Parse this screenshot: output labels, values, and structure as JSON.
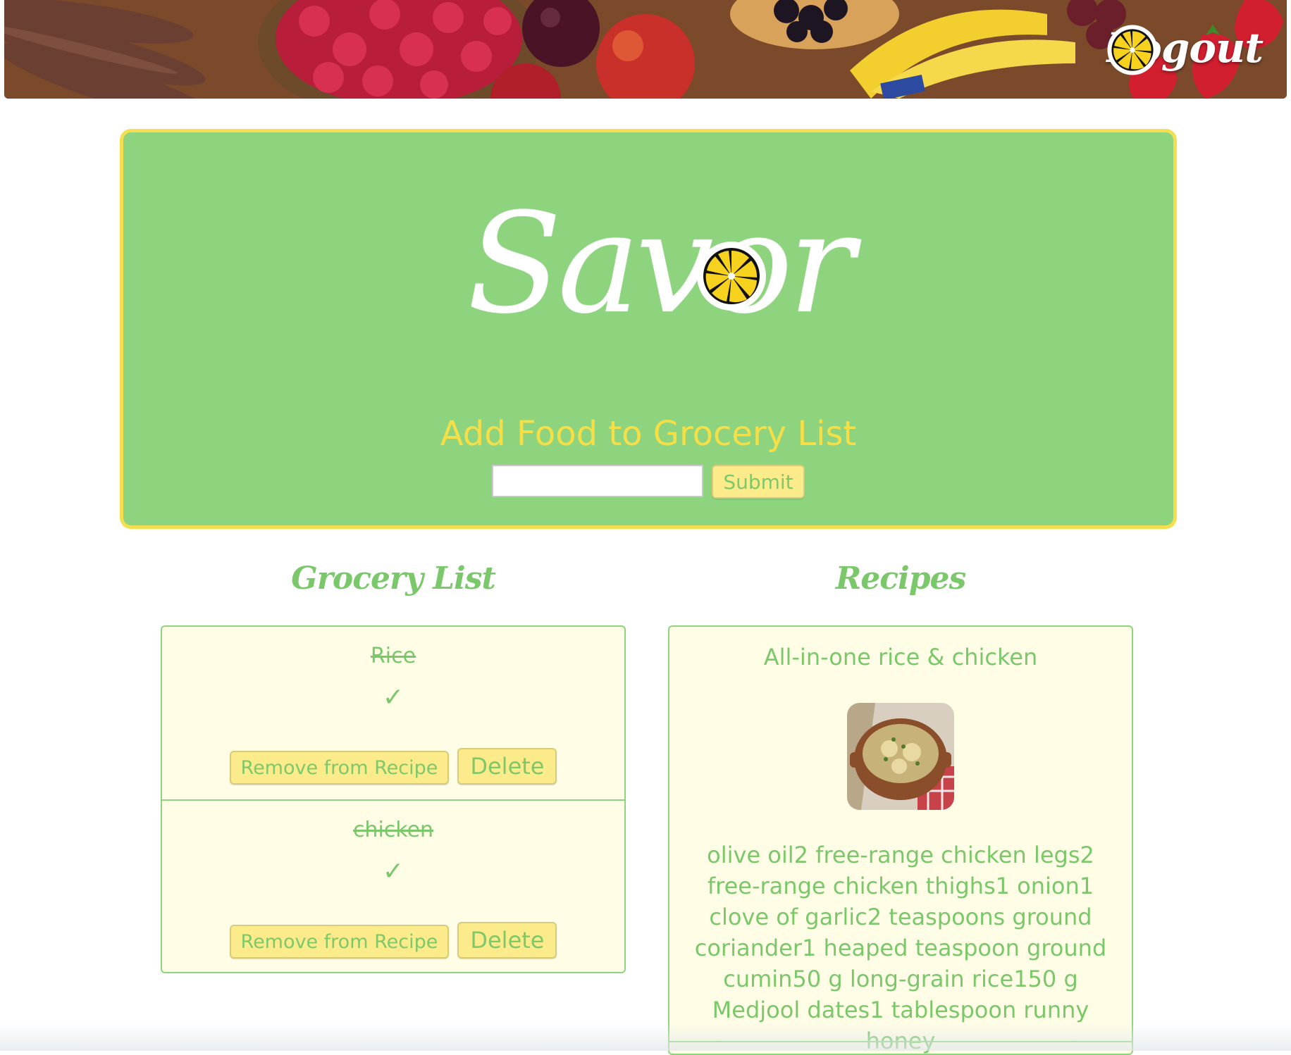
{
  "header": {
    "logout_label": "Logout",
    "logout_icon": "lemon-slice-icon"
  },
  "hero": {
    "logo_text": "Savor",
    "logo_icon": "lemon-slice-icon",
    "add_title": "Add Food to Grocery List",
    "input_value": "",
    "submit_label": "Submit"
  },
  "grocery": {
    "title": "Grocery List",
    "items": [
      {
        "name": "Rice",
        "check": "✓",
        "remove_label": "Remove from Recipe",
        "delete_label": "Delete"
      },
      {
        "name": "chicken",
        "check": "✓",
        "remove_label": "Remove from Recipe",
        "delete_label": "Delete"
      }
    ]
  },
  "recipes": {
    "title": "Recipes",
    "items": [
      {
        "title": "All-in-one rice & chicken",
        "ingredients": "olive oil2 free-range chicken legs2 free-range chicken thighs1 onion1 clove of garlic2 teaspoons ground coriander1 heaped teaspoon ground cumin50 g long-grain rice150 g Medjool dates1 tablespoon runny honey"
      }
    ]
  },
  "colors": {
    "hero_green": "#8ed47e",
    "border_yellow": "#f5df50",
    "title_yellow": "#f6de47",
    "text_green": "#7ac86a",
    "button_yellow": "#fbeb8a",
    "panel_cream": "#fffde6"
  }
}
